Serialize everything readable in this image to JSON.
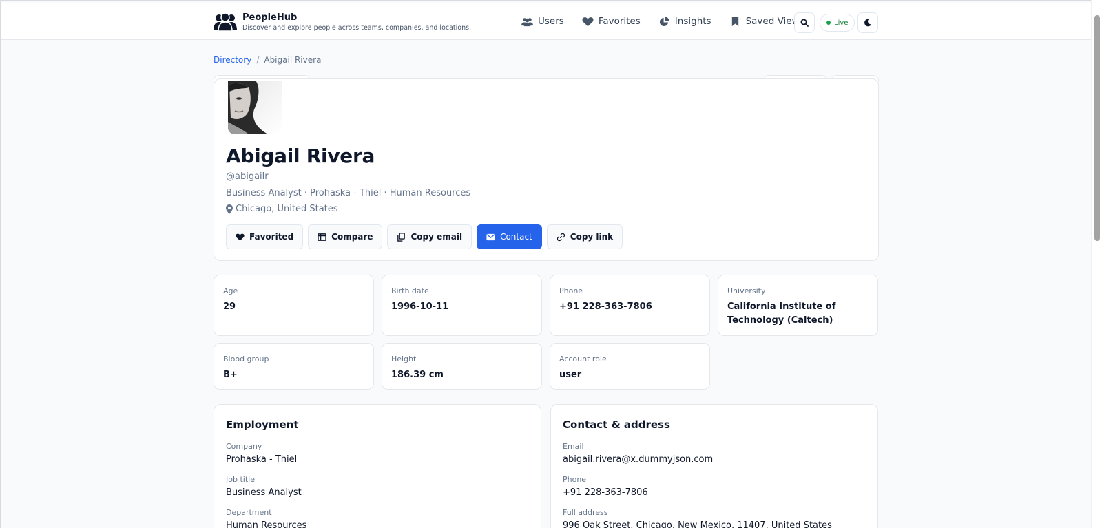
{
  "app": {
    "name": "PeopleHub",
    "tagline": "Discover and explore people across teams, companies, and locations."
  },
  "nav": {
    "users": "Users",
    "favorites": "Favorites",
    "insights": "Insights",
    "saved_views": "Saved Views",
    "live": "Live"
  },
  "breadcrumb": {
    "root": "Directory",
    "separator": "/",
    "current": "Abigail Rivera"
  },
  "profile": {
    "name": "Abigail Rivera",
    "handle": "@abigailr",
    "role_line": "Business Analyst · Prohaska - Thiel · Human Resources",
    "location": "Chicago, United States"
  },
  "actions": {
    "favorited": "Favorited",
    "compare": "Compare",
    "copy_email": "Copy email",
    "contact": "Contact",
    "copy_link": "Copy link"
  },
  "stats": [
    {
      "label": "Age",
      "value": "29"
    },
    {
      "label": "Birth date",
      "value": "1996-10-11"
    },
    {
      "label": "Phone",
      "value": "+91 228-363-7806"
    },
    {
      "label": "University",
      "value": "California Institute of Technology (Caltech)"
    },
    {
      "label": "Blood group",
      "value": "B+"
    },
    {
      "label": "Height",
      "value": "186.39 cm"
    },
    {
      "label": "Account role",
      "value": "user"
    }
  ],
  "employment": {
    "title": "Employment",
    "fields": [
      {
        "label": "Company",
        "value": "Prohaska - Thiel"
      },
      {
        "label": "Job title",
        "value": "Business Analyst"
      },
      {
        "label": "Department",
        "value": "Human Resources"
      }
    ]
  },
  "contact": {
    "title": "Contact & address",
    "fields": [
      {
        "label": "Email",
        "value": "abigail.rivera@x.dummyjson.com"
      },
      {
        "label": "Phone",
        "value": "+91 228-363-7806"
      },
      {
        "label": "Full address",
        "value": "996 Oak Street, Chicago, New Mexico, 11407, United States"
      }
    ]
  },
  "colors": {
    "accent": "#2563eb",
    "live": "#16a34a"
  }
}
